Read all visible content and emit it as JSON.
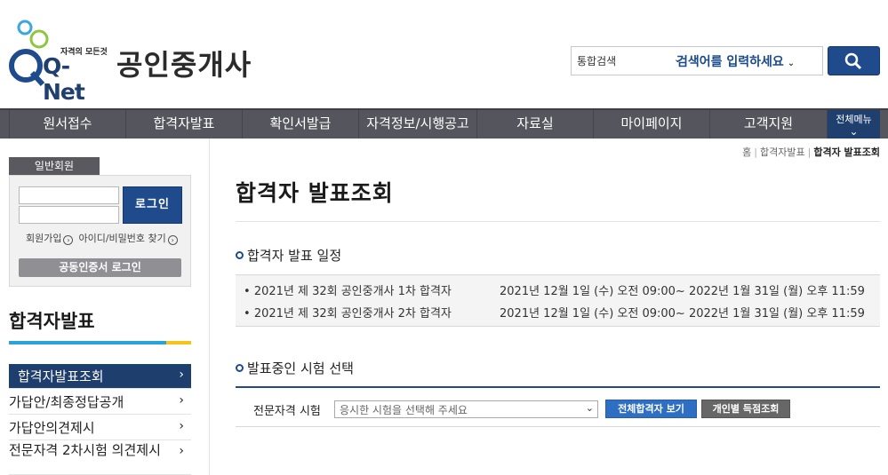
{
  "brand": {
    "logo_tagline": "자격의 모든것",
    "logo_text": "Q-Net",
    "site_name": "공인중개사"
  },
  "search": {
    "scope_label": "통합검색",
    "placeholder": "검색어를 입력하세요",
    "button_icon": "search-icon"
  },
  "gnb": {
    "items": [
      "원서접수",
      "합격자발표",
      "확인서발급",
      "자격정보/시행공고",
      "자료실",
      "마이페이지",
      "고객지원"
    ],
    "all_menu_label": "전체메뉴"
  },
  "sidebar": {
    "member_tab": "일반회원",
    "login_button": "로그인",
    "join_link": "회원가입",
    "find_link": "아이디/비밀번호 찾기",
    "cert_login": "공동인증서 로그인",
    "section_title": "합격자발표",
    "items": [
      {
        "label": "합격자발표조회",
        "active": true
      },
      {
        "label": "가답안/최종정답공개",
        "active": false
      },
      {
        "label": "가답안의견제시",
        "active": false
      },
      {
        "label": "전문자격 2차시험 의견제시",
        "active": false
      }
    ]
  },
  "breadcrumb": {
    "items": [
      "홈",
      "합격자발표"
    ],
    "current": "합격자 발표조회"
  },
  "main": {
    "page_title": "합격자 발표조회",
    "schedule_title": "합격자 발표 일정",
    "schedule": [
      {
        "exam": "2021년 제 32회 공인중개사 1차 합격자",
        "period": "2021년 12월 1일 (수) 오전 09:00~ 2022년 1월 31일 (월) 오후 11:59"
      },
      {
        "exam": "2021년 제 32회 공인중개사 2차 합격자",
        "period": "2021년 12월 1일 (수) 오전 09:00~ 2022년 1월 31일 (월) 오후 11:59"
      }
    ],
    "select_title": "발표중인 시험 선택",
    "select_label": "전문자격 시험",
    "select_value": "응시한 시험을 선택해 주세요",
    "all_pass_button": "전체합격자 보기",
    "score_button": "개인별 득점조회"
  },
  "colors": {
    "primary": "#1f4b8c",
    "gnb_bg": "#55555e",
    "accent_blue": "#2aa3d8",
    "accent_yellow": "#f6c21c"
  }
}
